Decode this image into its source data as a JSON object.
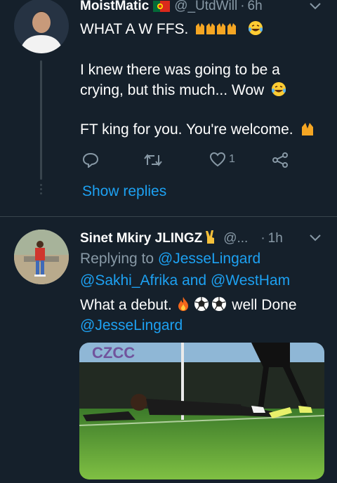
{
  "tweet1": {
    "name": "MoistMatic",
    "handle": "@_UtdWill",
    "sep": "·",
    "time": "6h",
    "line1": "WHAT A W FFS.",
    "para2": "I knew there was going to be a crying, but this much... Wow",
    "para3": "FT king for you. You're welcome.",
    "like_count": "1",
    "show_replies": "Show replies"
  },
  "tweet2": {
    "name": "Sinet Mkiry JLINGZ",
    "handle": "@...",
    "sep": "·",
    "time": "1h",
    "replying_to": "Replying to",
    "mention1": "@JesseLingard",
    "mention2": "@Sakhi_Afrika",
    "and": "and",
    "mention3": "@WestHam",
    "text_start": "What a debut.",
    "text_end": "well Done",
    "mention4": "@JesseLingard"
  },
  "colors": {
    "background": "#15202b",
    "text": "#ffffff",
    "muted": "#8899a6",
    "accent": "#1da1f2",
    "border": "#38444d"
  },
  "icons": [
    "reply-icon",
    "retweet-icon",
    "like-icon",
    "share-icon",
    "chevron-down-icon"
  ]
}
